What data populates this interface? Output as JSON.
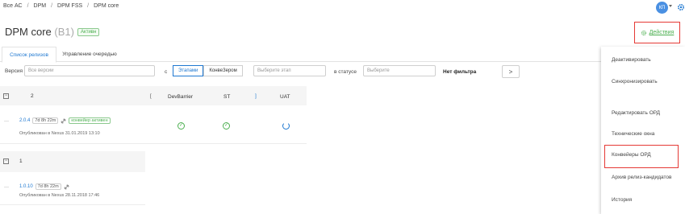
{
  "breadcrumb": [
    "Все АС",
    "DPM",
    "DPM FSS",
    "DPM core"
  ],
  "breadcrumb_sep": "/",
  "user": {
    "initials": "КП"
  },
  "page": {
    "title": "DPM core",
    "title_suffix": "(B1)",
    "status_badge": "Активн"
  },
  "actions_button": {
    "label": "Действия"
  },
  "tabs": [
    {
      "label": "Список релизов"
    },
    {
      "label": "Управление очередью"
    }
  ],
  "filters": {
    "version_label": "Версия",
    "version_placeholder": "Все версии",
    "from_label": "с",
    "segments": [
      {
        "label": "Этапами",
        "active": true
      },
      {
        "label": "КонвеЗером",
        "active": false
      }
    ],
    "stage_placeholder": "Выберите этап",
    "status_label": "в статусе",
    "status_placeholder": "Выберите",
    "no_filter": "Нет фильтра",
    "next_label": ">"
  },
  "groups": [
    {
      "number": "2",
      "bracket_left": "[",
      "bracket_right": "]"
    },
    {
      "number": "1"
    }
  ],
  "columns": [
    "DevBarrier",
    "ST",
    "UAT"
  ],
  "releases": [
    {
      "version": "2.0.4",
      "duration": "7d 8h 22m",
      "pipeline_tag": "конвейер активен",
      "published": "Опубликован в Nexus 31.01.2019 13:10",
      "statuses": [
        "ok",
        "ok",
        "running"
      ]
    },
    {
      "version": "1.0.10",
      "duration": "7d 8h 22m",
      "published": "Опубликован в Nexus 28.11.2018 17:46"
    }
  ],
  "menu": {
    "items": [
      {
        "label": "Деактивировать"
      },
      {
        "label": "Синхронизировать"
      },
      {
        "label": "Редактировать ОРД"
      },
      {
        "label": "Технические окна"
      },
      {
        "label": "Конвейеры ОРД"
      },
      {
        "label": "Архив релиз-кандидатов"
      },
      {
        "label": "История"
      }
    ],
    "highlighted_index": 4
  },
  "colors": {
    "accent": "#1f78d1",
    "success": "#4caf50",
    "highlight": "#e53935"
  }
}
